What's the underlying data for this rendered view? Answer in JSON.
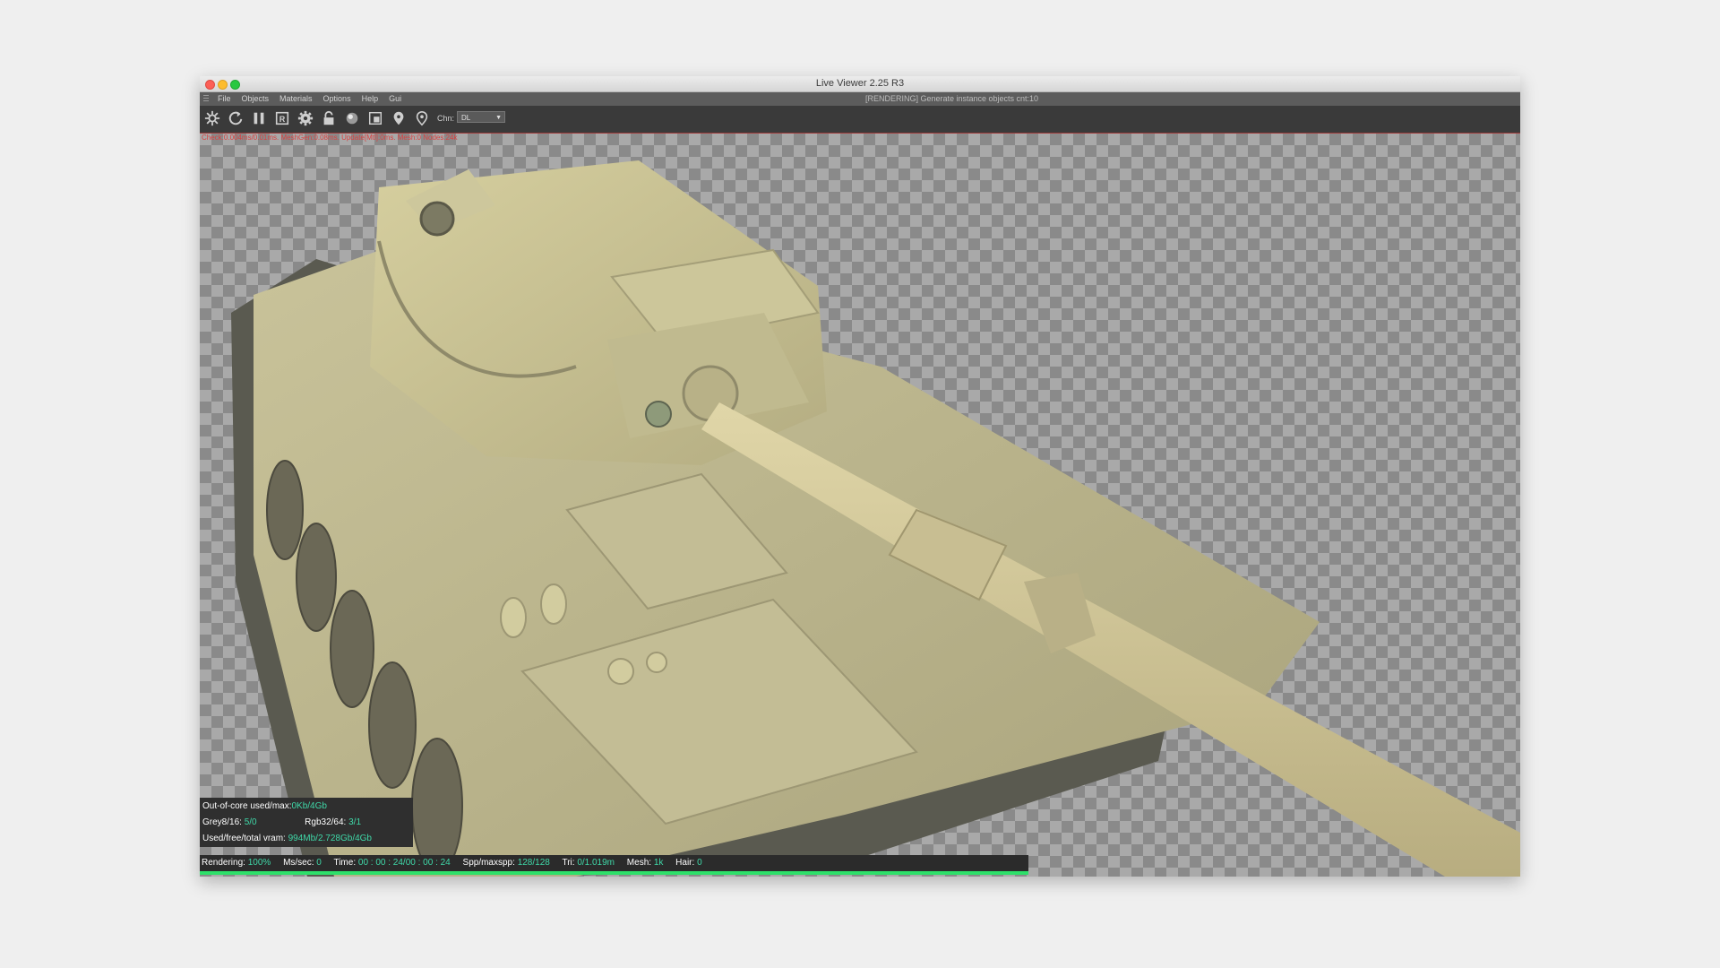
{
  "window": {
    "title": "Live Viewer 2.25 R3"
  },
  "menubar": {
    "items": [
      "File",
      "Objects",
      "Materials",
      "Options",
      "Help",
      "Gui"
    ],
    "status_message": "[RENDERING] Generate instance objects cnt:10"
  },
  "toolbar": {
    "icons": [
      "settings-gear-icon",
      "refresh-icon",
      "pause-icon",
      "region-render-icon",
      "options-gear-icon",
      "lock-icon",
      "material-ball-icon",
      "clay-mode-icon",
      "pick-focus-icon",
      "pick-material-icon"
    ],
    "chn_label": "Chn:",
    "chn_value": "DL"
  },
  "viewport": {
    "debug_line": "Check:0.004ms/0.01ms. MeshGen:0.08ms. Update[Mtl]:0ms. Mesh:0 Nodes:24k",
    "content": "tank-render"
  },
  "stats": {
    "out_of_core_label": "Out-of-core used/max:",
    "out_of_core_value": "0Kb/4Gb",
    "grey_label": "Grey8/16:",
    "grey_value": "5/0",
    "rgb_label": "Rgb32/64:",
    "rgb_value": "3/1",
    "vram_label": "Used/free/total vram:",
    "vram_value": "994Mb/2.728Gb/4Gb"
  },
  "statusbar": {
    "rendering_label": "Rendering:",
    "rendering_value": "100%",
    "ms_label": "Ms/sec:",
    "ms_value": "0",
    "time_label": "Time:",
    "time_value": "00 : 00 : 24/00 : 00 : 24",
    "spp_label": "Spp/maxspp:",
    "spp_value": "128/128",
    "tri_label": "Tri:",
    "tri_value": "0/1.019m",
    "mesh_label": "Mesh:",
    "mesh_value": "1k",
    "hair_label": "Hair:",
    "hair_value": "0",
    "progress_fraction": 1.0
  },
  "colors": {
    "accent_value": "#3fd8a8",
    "progress": "#2ee06a",
    "debug_text": "#d94040"
  }
}
